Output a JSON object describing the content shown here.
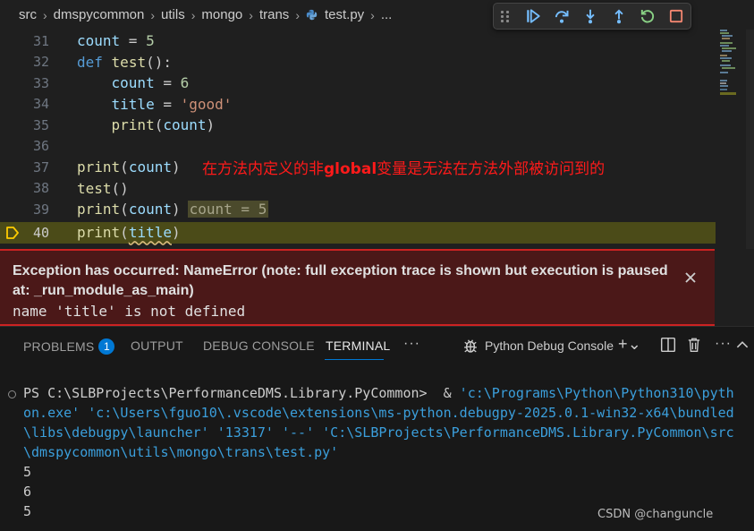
{
  "breadcrumb": {
    "segments": [
      "src",
      "dmspycommon",
      "utils",
      "mongo",
      "trans",
      "test.py",
      "..."
    ]
  },
  "debug_toolbar": {
    "buttons": [
      {
        "name": "continue",
        "icon": "continue-icon",
        "color": "#75beff"
      },
      {
        "name": "step-over",
        "icon": "step-over-icon",
        "color": "#75beff"
      },
      {
        "name": "step-into",
        "icon": "step-into-icon",
        "color": "#75beff"
      },
      {
        "name": "step-out",
        "icon": "step-out-icon",
        "color": "#75beff"
      },
      {
        "name": "restart",
        "icon": "restart-icon",
        "color": "#89d185"
      },
      {
        "name": "stop",
        "icon": "stop-icon",
        "color": "#f48771"
      }
    ]
  },
  "editor": {
    "line_numbers": [
      "31",
      "32",
      "33",
      "34",
      "35",
      "36",
      "37",
      "38",
      "39",
      "40"
    ],
    "current_line": "40",
    "code": {
      "l31": {
        "a": "count",
        "b": " = ",
        "c": "5"
      },
      "l32": {
        "kw": "def",
        "fn": "test",
        "rest": "():"
      },
      "l33": {
        "a": "count",
        "b": " = ",
        "c": "6"
      },
      "l34": {
        "a": "title",
        "b": " = ",
        "c": "'good'"
      },
      "l35": {
        "fn": "print",
        "p1": "(",
        "arg": "count",
        "p2": ")"
      },
      "l37": {
        "fn": "print",
        "p1": "(",
        "arg": "count",
        "p2": ")"
      },
      "l38": {
        "fn": "test",
        "rest": "()"
      },
      "l39": {
        "fn": "print",
        "p1": "(",
        "arg": "count",
        "p2": ")"
      },
      "l40": {
        "fn": "print",
        "p1": "(",
        "arg": "title",
        "p2": ")"
      }
    },
    "inline_value": "count = 5",
    "annotation": {
      "pre": "在方法内定义的非",
      "bold": "global",
      "post": "变量是无法在方法外部被访问到的"
    }
  },
  "exception": {
    "title": "Exception has occurred: NameError       (note: full exception trace is shown but execution is paused at: _run_module_as_main)",
    "message": "name 'title' is not defined"
  },
  "panel": {
    "tabs": {
      "problems": "PROBLEMS",
      "problems_badge": "1",
      "output": "OUTPUT",
      "debug_console": "DEBUG CONSOLE",
      "terminal": "TERMINAL"
    },
    "active_tab": "TERMINAL",
    "more": "···",
    "terminal_name": "Python Debug Console",
    "add_caret": "+⌄"
  },
  "terminal": {
    "prompt": "PS C:\\SLBProjects\\PerformanceDMS.Library.PyCommon> ",
    "cmd_amp": " & ",
    "cmd_l1": "'c:\\Programs\\Python\\Python310\\pyth",
    "cmd_l2": "on.exe' 'c:\\Users\\fguo10\\.vscode\\extensions\\ms-python.debugpy-2025.0.1-win32-x64\\bundled",
    "cmd_l3": "\\libs\\debugpy\\launcher' '13317' '--' 'C:\\SLBProjects\\PerformanceDMS.Library.PyCommon\\src",
    "cmd_l4": "\\dmspycommon\\utils\\mongo\\trans\\test.py'",
    "output": [
      "5",
      "6",
      "5"
    ]
  },
  "watermark": "CSDN @changuncle"
}
